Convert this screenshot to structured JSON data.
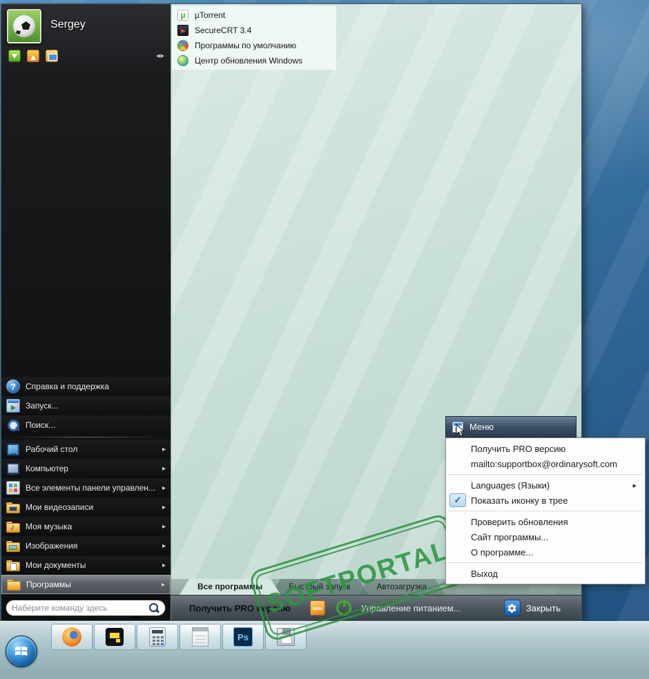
{
  "user": {
    "name": "Sergey"
  },
  "left_menu": {
    "items": [
      {
        "label": "Справка и поддержка"
      },
      {
        "label": "Запуск..."
      },
      {
        "label": "Поиск..."
      },
      {
        "label": "Рабочий стол"
      },
      {
        "label": "Компьютер"
      },
      {
        "label": "Все элементы панели управлен..."
      },
      {
        "label": "Мои видеозаписи"
      },
      {
        "label": "Моя музыка"
      },
      {
        "label": "Изображения"
      },
      {
        "label": "Мои документы"
      },
      {
        "label": "Программы"
      }
    ],
    "search_placeholder": "Наберите команду здесь"
  },
  "programs_flyout": {
    "items": [
      {
        "label": "µTorrent"
      },
      {
        "label": "SecureCRT 3.4"
      },
      {
        "label": "Программы по умолчанию"
      },
      {
        "label": "Центр обновления Windows"
      }
    ]
  },
  "tabs": [
    {
      "label": "Все программы"
    },
    {
      "label": "Быстрый запуск"
    },
    {
      "label": "Автозагрузка"
    }
  ],
  "bottom_bar": {
    "pro": "Получить PRO версию",
    "power": "Управление питанием...",
    "close": "Закрыть"
  },
  "context_menu": {
    "header": "Меню",
    "items": [
      {
        "label": "Получить PRO версию"
      },
      {
        "label": "mailto:supportbox@ordinarysoft.com"
      },
      {
        "label": "Languages (Языки)"
      },
      {
        "label": "Показать иконку в трее"
      },
      {
        "label": "Проверить обновления"
      },
      {
        "label": "Сайт программы..."
      },
      {
        "label": "О программе..."
      },
      {
        "label": "Выход"
      }
    ]
  },
  "watermark": {
    "text": "SOFTPORTAL"
  },
  "taskbar": {
    "ps_label": "Ps"
  },
  "colors": {
    "accent_blue": "#2a6fc0",
    "stamp_green": "#2f9440",
    "panel_green": "#c6ded6"
  }
}
